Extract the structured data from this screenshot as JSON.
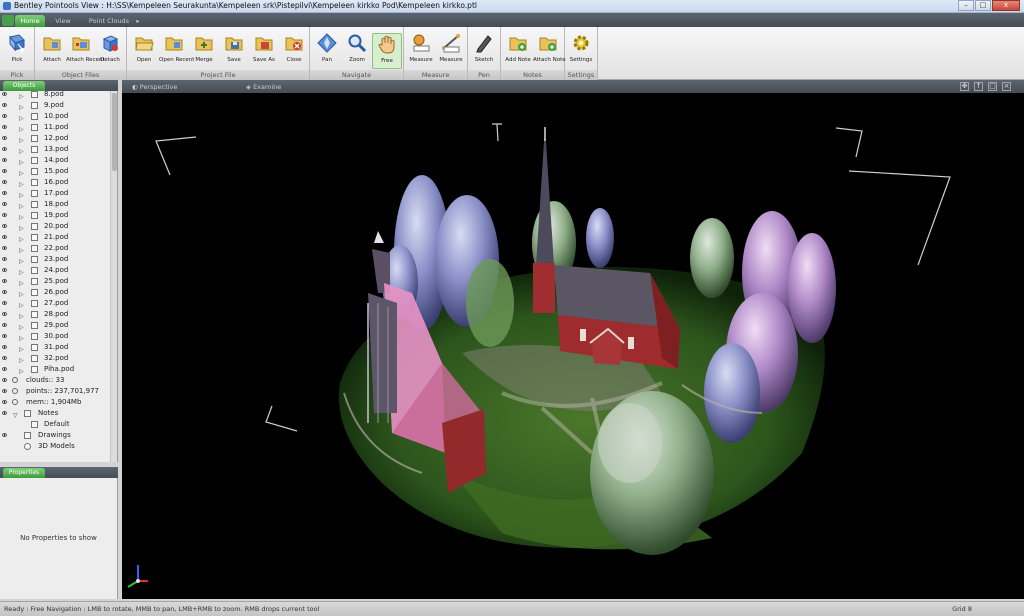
{
  "window": {
    "title": "Bentley Pointools View : H:\\SS\\Kempeleen Seurakunta\\Kempeleen srk\\Pistepilvi\\Kempeleen kirkko Pod\\Kempeleen kirkko.ptl",
    "minimize": "–",
    "maximize": "□",
    "close": "x"
  },
  "ribbon_tabs": [
    "Home",
    "View",
    "Point Clouds"
  ],
  "ribbon": {
    "groups": [
      {
        "name": "Pick",
        "buttons": [
          "Pick"
        ]
      },
      {
        "name": "Object Files",
        "buttons": [
          "Attach",
          "Attach Recent",
          "Detach"
        ]
      },
      {
        "name": "Project File",
        "buttons": [
          "Open",
          "Open Recent",
          "Merge",
          "Save",
          "Save As",
          "Close"
        ]
      },
      {
        "name": "Navigate",
        "buttons": [
          "Pan",
          "Zoom",
          "Free"
        ]
      },
      {
        "name": "Measure",
        "buttons": [
          "Measure",
          "Measure"
        ]
      },
      {
        "name": "Pen",
        "buttons": [
          "Sketch"
        ]
      },
      {
        "name": "Notes",
        "buttons": [
          "Add Note",
          "Attach Note"
        ]
      },
      {
        "name": "Settings",
        "buttons": [
          "Settings"
        ]
      }
    ],
    "active_button": "Free"
  },
  "objects_panel": {
    "tab": "Objects",
    "pods": [
      "8.pod",
      "9.pod",
      "10.pod",
      "11.pod",
      "12.pod",
      "13.pod",
      "14.pod",
      "15.pod",
      "16.pod",
      "17.pod",
      "18.pod",
      "19.pod",
      "20.pod",
      "21.pod",
      "22.pod",
      "23.pod",
      "24.pod",
      "25.pod",
      "26.pod",
      "27.pod",
      "28.pod",
      "29.pod",
      "30.pod",
      "31.pod",
      "32.pod",
      "Piha.pod"
    ],
    "info": [
      "clouds:: 33",
      "points:: 237,701,977",
      "mem:: 1,904Mb"
    ],
    "notes": {
      "label": "Notes",
      "children": [
        "Default"
      ]
    },
    "drawings": "Drawings",
    "models": "3D Models"
  },
  "properties_panel": {
    "tab": "Properties",
    "empty_text": "No Properties to show"
  },
  "viewport": {
    "tabs": [
      "Perspective",
      "Examine"
    ]
  },
  "status": {
    "message": "Ready : Free Navigation : LMB to rotate, MMB to pan, LMB+RMB to zoom. RMB drops current tool",
    "grid": "Grid 8"
  }
}
